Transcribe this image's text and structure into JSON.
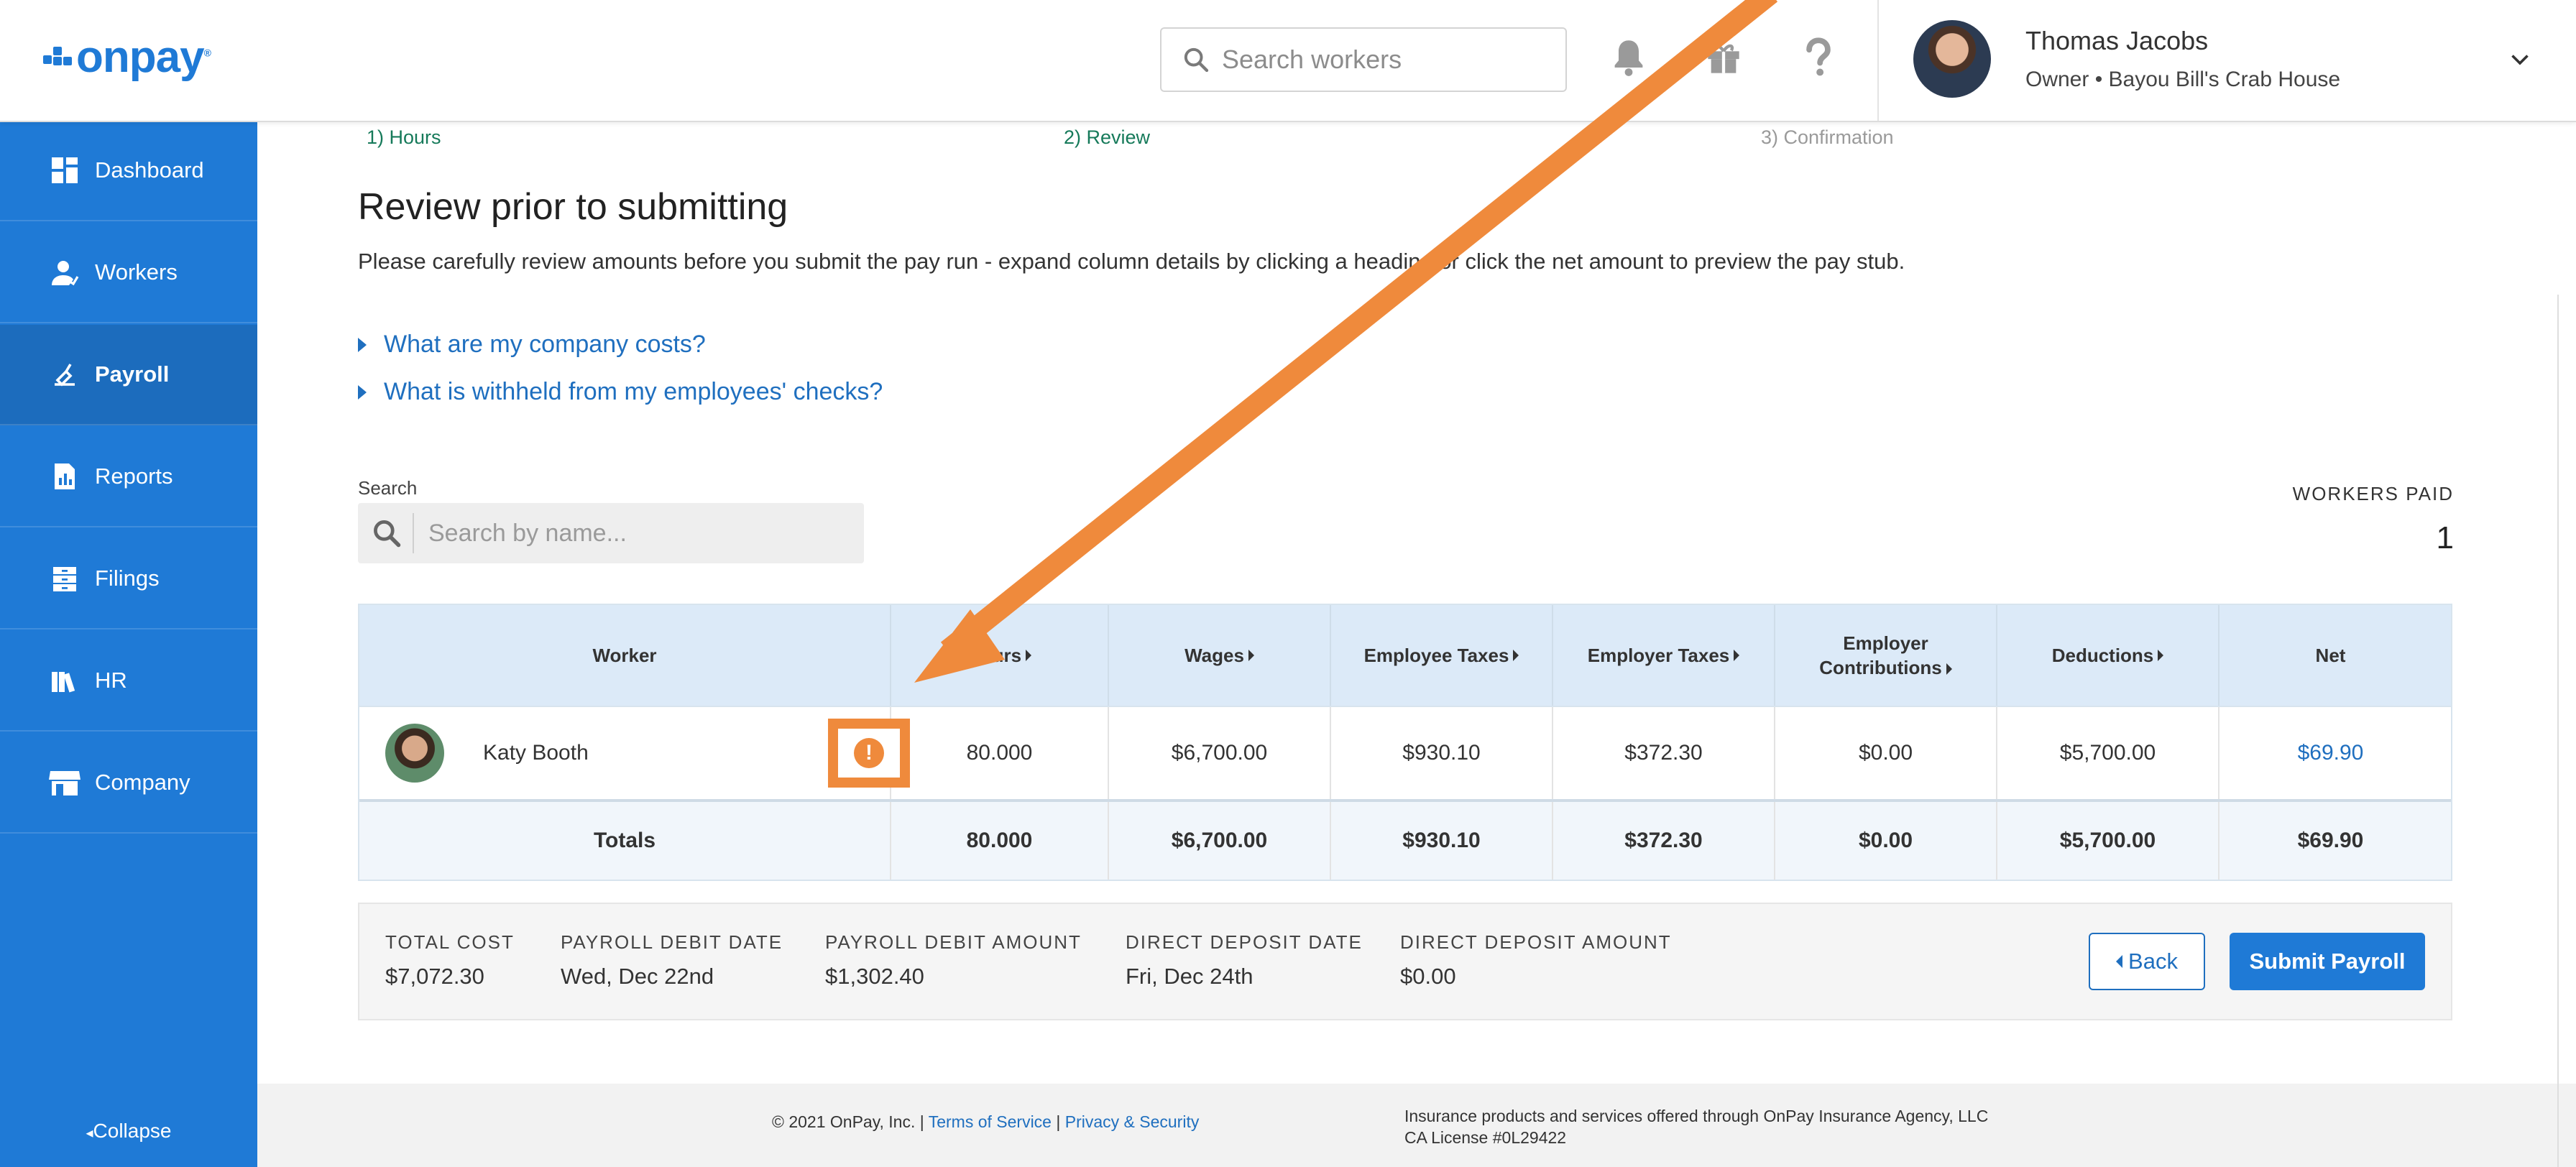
{
  "header": {
    "logo_text": "onpay",
    "logo_reg": "®",
    "search_placeholder": "Search workers",
    "icons": [
      "bell-icon",
      "gift-icon",
      "help-icon"
    ],
    "user": {
      "name": "Thomas Jacobs",
      "role": "Owner • Bayou Bill's Crab House"
    }
  },
  "sidebar": {
    "items": [
      {
        "label": "Dashboard",
        "icon": "dashboard-icon"
      },
      {
        "label": "Workers",
        "icon": "workers-icon"
      },
      {
        "label": "Payroll",
        "icon": "payroll-icon",
        "active": true
      },
      {
        "label": "Reports",
        "icon": "reports-icon"
      },
      {
        "label": "Filings",
        "icon": "filings-icon"
      },
      {
        "label": "HR",
        "icon": "hr-icon"
      },
      {
        "label": "Company",
        "icon": "company-icon"
      }
    ],
    "collapse_label": "Collapse"
  },
  "steps": [
    "1) Hours",
    "2) Review",
    "3) Confirmation"
  ],
  "page": {
    "title": "Review prior to submitting",
    "description": "Please carefully review amounts before you submit the pay run - expand column details by clicking a heading or click the net amount to preview the pay stub.",
    "faq": [
      "What are my company costs?",
      "What is withheld from my employees' checks?"
    ],
    "search_label": "Search",
    "search_placeholder": "Search by name...",
    "workers_paid_label": "WORKERS PAID",
    "workers_paid_value": "1"
  },
  "table": {
    "headers": [
      "Worker",
      "Hours",
      "Wages",
      "Employee Taxes",
      "Employer Taxes",
      "Employer Contributions",
      "Deductions",
      "Net"
    ],
    "rows": [
      {
        "worker": "Katy Booth",
        "hours": "80.000",
        "wages": "$6,700.00",
        "employee_taxes": "$930.10",
        "employer_taxes": "$372.30",
        "employer_contributions": "$0.00",
        "deductions": "$5,700.00",
        "net": "$69.90"
      }
    ],
    "totals": {
      "label": "Totals",
      "hours": "80.000",
      "wages": "$6,700.00",
      "employee_taxes": "$930.10",
      "employer_taxes": "$372.30",
      "employer_contributions": "$0.00",
      "deductions": "$5,700.00",
      "net": "$69.90"
    },
    "warning_icon": "!"
  },
  "summary": {
    "total_cost_label": "TOTAL COST",
    "total_cost": "$7,072.30",
    "debit_date_label": "PAYROLL DEBIT DATE",
    "debit_date": "Wed, Dec 22nd",
    "debit_amount_label": "PAYROLL DEBIT AMOUNT",
    "debit_amount": "$1,302.40",
    "dd_date_label": "DIRECT DEPOSIT DATE",
    "dd_date": "Fri, Dec 24th",
    "dd_amount_label": "DIRECT DEPOSIT AMOUNT",
    "dd_amount": "$0.00",
    "back_label": "Back",
    "submit_label": "Submit Payroll"
  },
  "footer": {
    "copyright": "© 2021 OnPay, Inc. |",
    "terms": "Terms of Service",
    "pipe": "|",
    "privacy": "Privacy & Security",
    "insurance_line1": "Insurance products and services offered through OnPay Insurance Agency, LLC",
    "insurance_line2": "CA License #0L29422"
  },
  "colors": {
    "brand_blue": "#1f7ad6",
    "annotation_orange": "#ef8a3c",
    "step_green": "#167a5a"
  }
}
